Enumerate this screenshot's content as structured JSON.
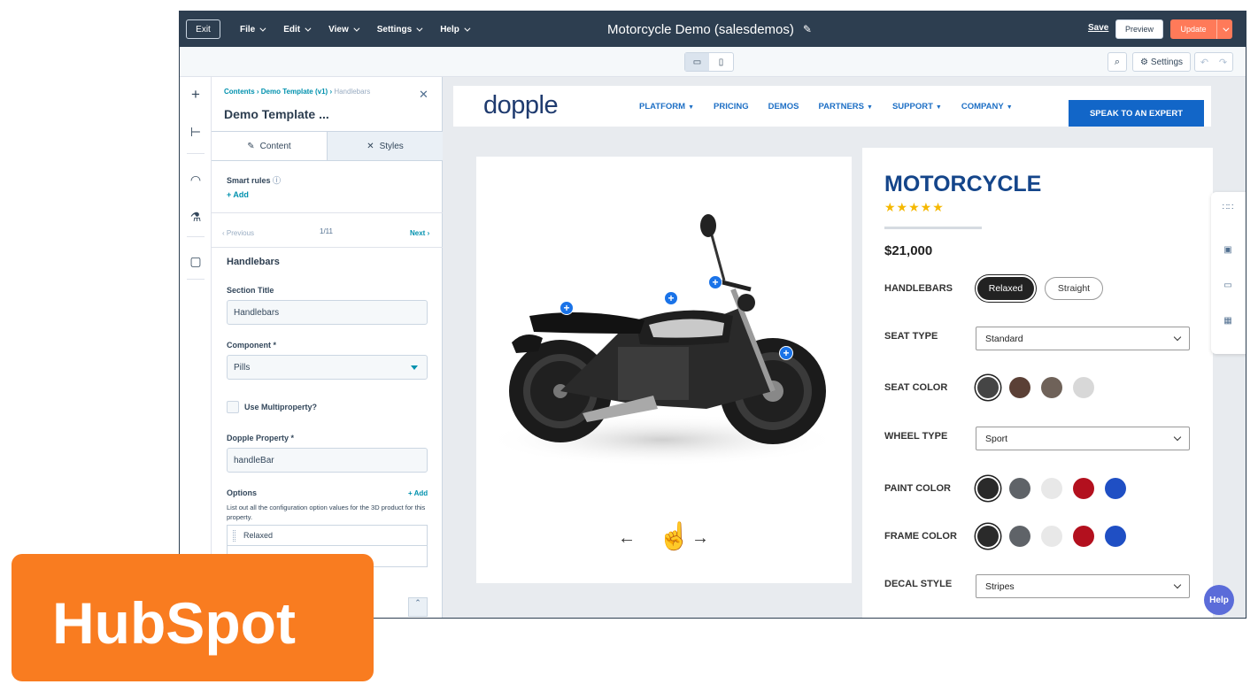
{
  "topbar": {
    "exit": "Exit",
    "menus": [
      "File",
      "Edit",
      "View",
      "Settings",
      "Help"
    ],
    "title": "Motorcycle Demo (salesdemos)",
    "save": "Save",
    "preview": "Preview",
    "update": "Update"
  },
  "toolbar2": {
    "settings": "Settings"
  },
  "panel": {
    "crumbs": {
      "a": "Contents",
      "b": "Demo Template (v1)",
      "c": "Handlebars"
    },
    "title": "Demo Template ...",
    "tabs": {
      "content": "Content",
      "styles": "Styles"
    },
    "smart_rules": "Smart rules",
    "add": "+ Add",
    "previous": "‹ Previous",
    "pager": "1/11",
    "next": "Next ›",
    "section_heading": "Handlebars",
    "section_title_label": "Section Title",
    "section_title_value": "Handlebars",
    "component_label": "Component *",
    "component_value": "Pills",
    "multiproperty_label": "Use Multiproperty?",
    "property_label": "Dopple Property *",
    "property_value": "handleBar",
    "options_label": "Options",
    "options_add": "+ Add",
    "options_desc": "List out all the configuration option values for the 3D product for this property.",
    "option_1": "Relaxed"
  },
  "site": {
    "logo": "dopple",
    "nav": [
      "PLATFORM",
      "PRICING",
      "DEMOS",
      "PARTNERS",
      "SUPPORT",
      "COMPANY"
    ],
    "cta": "SPEAK TO AN EXPERT"
  },
  "product": {
    "title": "MOTORCYCLE",
    "rating": 5,
    "stars": "★★★★★",
    "price": "$21,000",
    "handlebars_label": "HANDLEBARS",
    "handlebars_options": [
      "Relaxed",
      "Straight"
    ],
    "seat_type_label": "SEAT TYPE",
    "seat_type_value": "Standard",
    "seat_color_label": "SEAT COLOR",
    "seat_colors": [
      "#454545",
      "#5b4036",
      "#6f6259",
      "#d8d8d8"
    ],
    "wheel_type_label": "WHEEL TYPE",
    "wheel_type_value": "Sport",
    "paint_color_label": "PAINT COLOR",
    "paint_colors": [
      "#2a2a2a",
      "#5f6368",
      "#e8e8e8",
      "#b3101e",
      "#1f4fc4"
    ],
    "frame_color_label": "FRAME COLOR",
    "frame_colors": [
      "#2a2a2a",
      "#5f6368",
      "#e8e8e8",
      "#b3101e",
      "#1f4fc4"
    ],
    "decal_style_label": "DECAL STYLE",
    "decal_style_value": "Stripes"
  },
  "help": "Help",
  "brand": {
    "name": "HubSpot",
    "color": "#f97c20"
  }
}
